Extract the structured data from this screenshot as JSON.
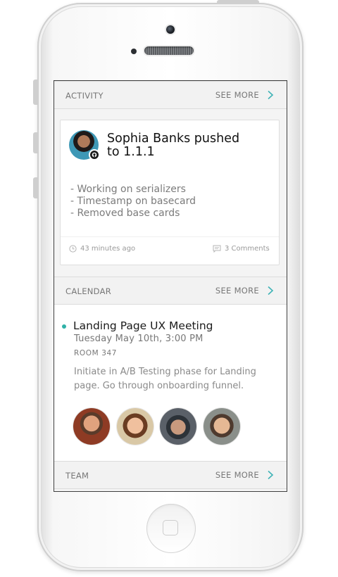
{
  "activity": {
    "header": "ACTIVITY",
    "see_more": "SEE MORE",
    "card": {
      "title": "Sophia Banks pushed to 1.1.1",
      "lines": [
        "- Working on serializers",
        "- Timestamp on basecard",
        "- Removed base cards"
      ],
      "time": "43 minutes ago",
      "comments": "3 Comments"
    }
  },
  "calendar": {
    "header": "CALENDAR",
    "see_more": "SEE MORE",
    "event": {
      "title": "Landing Page UX Meeting",
      "datetime": "Tuesday May 10th, 3:00 PM",
      "room": "ROOM 347",
      "description": "Initiate in A/B Testing phase for Landing page. Go through onboarding funnel."
    }
  },
  "team": {
    "header": "TEAM",
    "see_more": "SEE MORE"
  },
  "colors": {
    "accent": "#2fb1a7",
    "chevron": "#3fb3b6"
  },
  "icons": [
    "chevron-right-icon",
    "clock-icon",
    "comment-icon",
    "github-icon"
  ]
}
